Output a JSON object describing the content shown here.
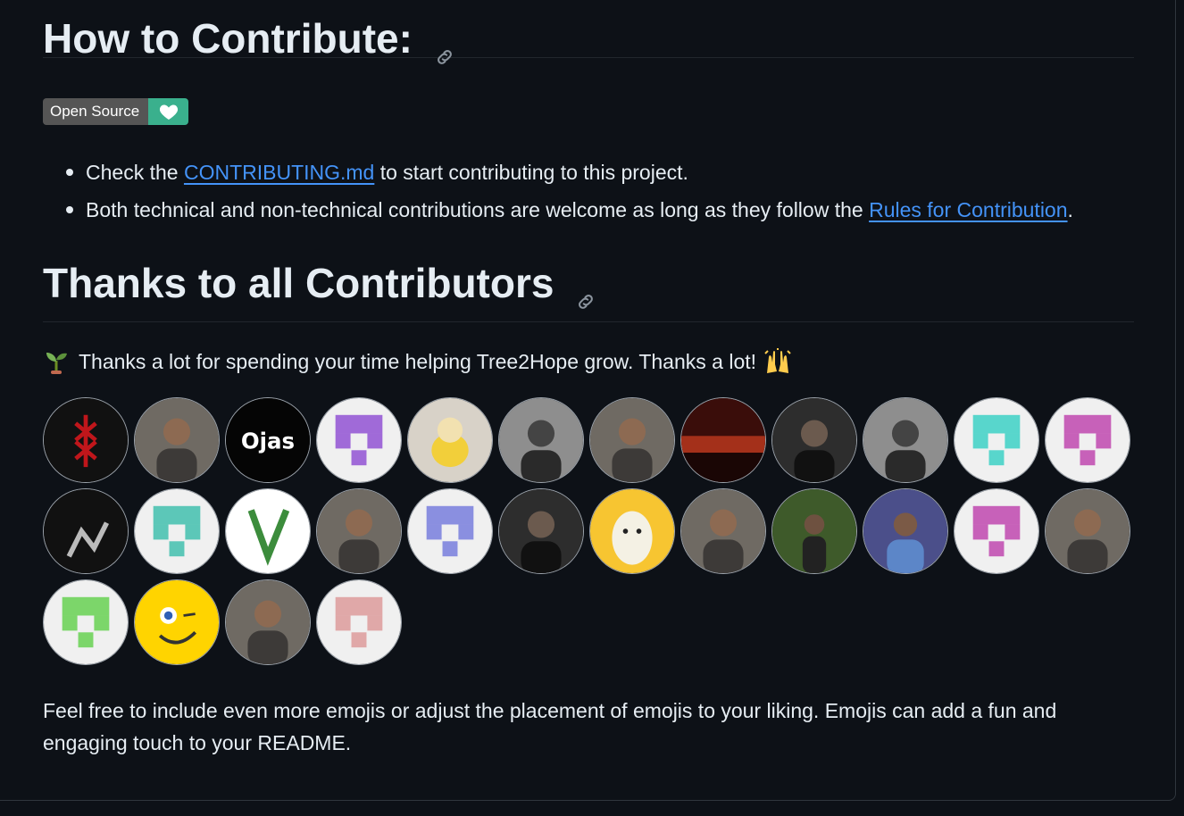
{
  "contribute": {
    "heading": "How to Contribute:",
    "badge": {
      "label": "Open Source",
      "icon": "heart-icon",
      "color": "#3ab08d"
    },
    "items": [
      {
        "before": "Check the ",
        "link": "CONTRIBUTING.md",
        "after": " to start contributing to this project."
      },
      {
        "before": "Both technical and non-technical contributions are welcome as long as they follow the ",
        "link": "Rules for Contribution",
        "after": "."
      }
    ]
  },
  "thanks": {
    "heading": "Thanks to all Contributors",
    "line": "Thanks a lot for spending your time helping Tree2Hope grow. Thanks a lot!",
    "emoji_start": "seedling-icon",
    "emoji_end": "raised-hands-icon",
    "avatar_count": 28
  },
  "footer": {
    "text": "Feel free to include even more emojis or adjust the placement of emojis to your liking. Emojis can add a fun and engaging touch to your README."
  },
  "avatars": [
    {
      "kind": "logo-red"
    },
    {
      "kind": "photo"
    },
    {
      "kind": "text",
      "text": "Ojas"
    },
    {
      "kind": "identicon",
      "color": "#a06ad8"
    },
    {
      "kind": "dog"
    },
    {
      "kind": "photo-gray"
    },
    {
      "kind": "photo"
    },
    {
      "kind": "sunset"
    },
    {
      "kind": "photo-dark"
    },
    {
      "kind": "photo-gray"
    },
    {
      "kind": "identicon",
      "color": "#58d6cc"
    },
    {
      "kind": "identicon",
      "color": "#c761b9"
    },
    {
      "kind": "dark-art"
    },
    {
      "kind": "identicon",
      "color": "#5cc7b8"
    },
    {
      "kind": "leaf-v"
    },
    {
      "kind": "photo"
    },
    {
      "kind": "identicon",
      "color": "#8a8fe0"
    },
    {
      "kind": "photo-dark"
    },
    {
      "kind": "cartoon-yellow"
    },
    {
      "kind": "photo"
    },
    {
      "kind": "photo-green"
    },
    {
      "kind": "photo-blue"
    },
    {
      "kind": "identicon",
      "color": "#c761b9"
    },
    {
      "kind": "photo"
    },
    {
      "kind": "identicon",
      "color": "#7cd66a"
    },
    {
      "kind": "smiley"
    },
    {
      "kind": "photo"
    },
    {
      "kind": "identicon",
      "color": "#e0a8a8"
    }
  ]
}
